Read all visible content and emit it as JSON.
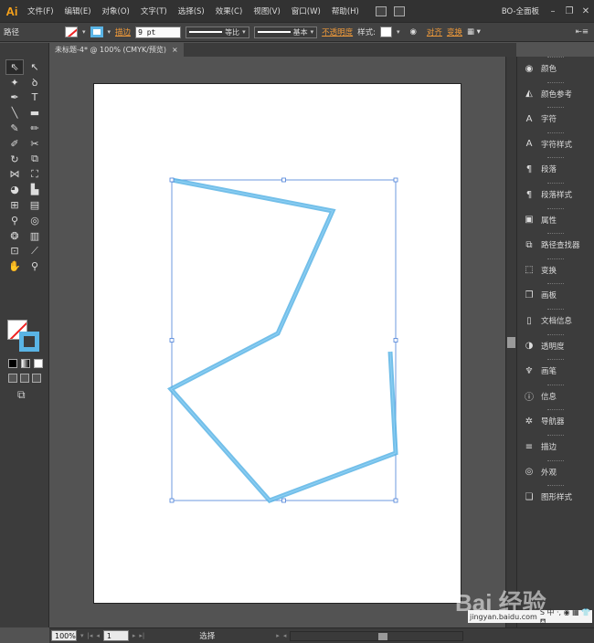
{
  "app": {
    "logo": "Ai",
    "workspace": "BO-全面板"
  },
  "menu": [
    "文件(F)",
    "编辑(E)",
    "对象(O)",
    "文字(T)",
    "选择(S)",
    "效果(C)",
    "视图(V)",
    "窗口(W)",
    "帮助(H)"
  ],
  "window_controls": {
    "minimize": "–",
    "restore": "❐",
    "close": "✕"
  },
  "control_bar": {
    "selection_type": "路径",
    "stroke_label": "描边",
    "stroke_weight": "9 pt",
    "profile": "等比",
    "brush": "基本",
    "opacity_label": "不透明度",
    "style_label": "样式:",
    "align_label": "对齐",
    "transform_label": "变换"
  },
  "document_tab": {
    "title": "未标题-4* @ 100% (CMYK/预览)",
    "close": "×"
  },
  "tools": [
    {
      "icon": "selection-tool-icon",
      "glyph": "⇖"
    },
    {
      "icon": "direct-selection-tool-icon",
      "glyph": "↖"
    },
    {
      "icon": "magic-wand-icon",
      "glyph": "✦"
    },
    {
      "icon": "lasso-icon",
      "glyph": "ꝺ"
    },
    {
      "icon": "pen-tool-icon",
      "glyph": "✒"
    },
    {
      "icon": "type-tool-icon",
      "glyph": "T"
    },
    {
      "icon": "line-tool-icon",
      "glyph": "╲"
    },
    {
      "icon": "rectangle-tool-icon",
      "glyph": "▬"
    },
    {
      "icon": "paintbrush-icon",
      "glyph": "✎"
    },
    {
      "icon": "pencil-icon",
      "glyph": "✏"
    },
    {
      "icon": "blob-brush-icon",
      "glyph": "✐"
    },
    {
      "icon": "scissors-icon",
      "glyph": "✂"
    },
    {
      "icon": "rotate-tool-icon",
      "glyph": "↻"
    },
    {
      "icon": "scale-tool-icon",
      "glyph": "⧉"
    },
    {
      "icon": "width-tool-icon",
      "glyph": "⋈"
    },
    {
      "icon": "free-transform-icon",
      "glyph": "⛶"
    },
    {
      "icon": "shape-builder-icon",
      "glyph": "◕"
    },
    {
      "icon": "perspective-grid-icon",
      "glyph": "▙"
    },
    {
      "icon": "mesh-tool-icon",
      "glyph": "⊞"
    },
    {
      "icon": "gradient-tool-icon",
      "glyph": "▤"
    },
    {
      "icon": "eyedropper-icon",
      "glyph": "⚲"
    },
    {
      "icon": "blend-tool-icon",
      "glyph": "◎"
    },
    {
      "icon": "symbol-sprayer-icon",
      "glyph": "❂"
    },
    {
      "icon": "column-graph-icon",
      "glyph": "▥"
    },
    {
      "icon": "artboard-tool-icon",
      "glyph": "⊡"
    },
    {
      "icon": "slice-tool-icon",
      "glyph": "⟋"
    },
    {
      "icon": "hand-tool-icon",
      "glyph": "✋"
    },
    {
      "icon": "zoom-tool-icon",
      "glyph": "⚲"
    }
  ],
  "status_bar": {
    "zoom": "100%",
    "artboard_number": "1",
    "current_tool": "选择"
  },
  "panels": [
    {
      "label": "颜色",
      "icon": "color-icon",
      "glyph": "◉"
    },
    {
      "label": "颜色参考",
      "icon": "color-guide-icon",
      "glyph": "◭"
    },
    {
      "label": "字符",
      "icon": "character-icon",
      "glyph": "A"
    },
    {
      "label": "字符样式",
      "icon": "character-styles-icon",
      "glyph": "A"
    },
    {
      "label": "段落",
      "icon": "paragraph-icon",
      "glyph": "¶"
    },
    {
      "label": "段落样式",
      "icon": "paragraph-styles-icon",
      "glyph": "¶"
    },
    {
      "label": "属性",
      "icon": "attributes-icon",
      "glyph": "▣"
    },
    {
      "label": "路径查找器",
      "icon": "pathfinder-icon",
      "glyph": "⧉"
    },
    {
      "label": "变换",
      "icon": "transform-icon",
      "glyph": "⬚"
    },
    {
      "label": "画板",
      "icon": "artboards-icon",
      "glyph": "❐"
    },
    {
      "label": "文档信息",
      "icon": "document-info-icon",
      "glyph": "▯"
    },
    {
      "label": "透明度",
      "icon": "transparency-icon",
      "glyph": "◑"
    },
    {
      "label": "画笔",
      "icon": "brushes-icon",
      "glyph": "♆"
    },
    {
      "label": "信息",
      "icon": "info-icon",
      "glyph": "ⓘ"
    },
    {
      "label": "导航器",
      "icon": "navigator-icon",
      "glyph": "✲"
    },
    {
      "label": "描边",
      "icon": "stroke-icon",
      "glyph": "≡"
    },
    {
      "label": "外观",
      "icon": "appearance-icon",
      "glyph": "◎"
    },
    {
      "label": "图形样式",
      "icon": "graphic-styles-icon",
      "glyph": "❏"
    }
  ],
  "artwork": {
    "stroke_color": "#5ab4e5",
    "selection_color": "#4a7fd8"
  },
  "watermark": {
    "brand": "Bai 经验",
    "site": "jingyan.baidu.com",
    "bar_glyphs": "S 中 ·, ◉ ▦ 👕 ⛾"
  }
}
